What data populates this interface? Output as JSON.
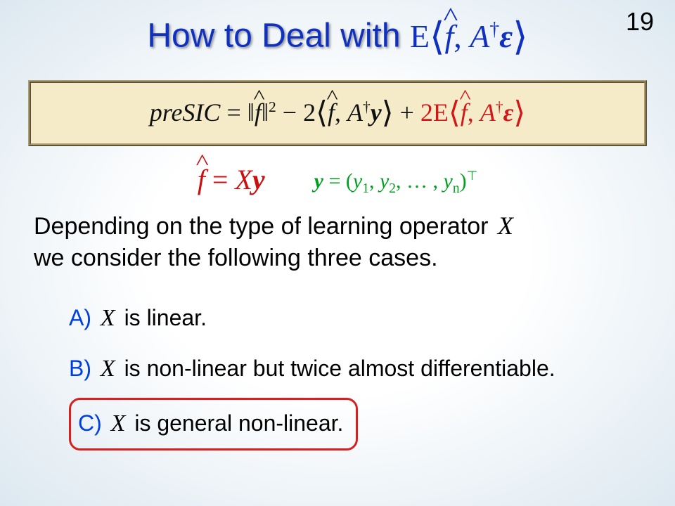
{
  "page_number": "19",
  "title": {
    "text": "How to Deal with ",
    "math_html": "E<span class='angle'>⟨</span><span class='ital hat'>f</span>, <span class='ital'>A</span><span class='sup'>†</span><span class='bold ital'>ε</span><span class='angle'>⟩</span>"
  },
  "formula": {
    "black_html": "<span class='ital'>preSIC</span> = ‖<span class='ital hat'>f</span>‖<span class='sup'>2</span> − 2<span class='angle'>⟨</span><span class='ital hat'>f</span>, <span class='ital'>A</span><span class='sup'>†</span><span class='bold ital'>y</span><span class='angle'>⟩</span> + ",
    "red_html": "2E<span class='angle'>⟨</span><span class='ital hat'>f</span>, <span class='ital'>A</span><span class='sup'>†</span><span class='bold ital'>ε</span><span class='angle'>⟩</span>"
  },
  "midline": {
    "red_html": "<span class='ital hat'>f</span> = <span class='ital'>X</span><span class='bold ital'>y</span>",
    "green_html": "<span class='bold ital'>y</span> = (<span class='ital'>y</span><span class='sub'>1</span>, <span class='ital'>y</span><span class='sub'>2</span>, … , <span class='ital'>y</span><span class='sub'>n</span>)<span class='sup'>⊤</span>"
  },
  "body": {
    "line1_a": "Depending on the type of learning operator ",
    "line1_x": "X",
    "line1_b": "we consider the following three cases."
  },
  "cases": {
    "a": {
      "label": "A)",
      "x": "X",
      "text": " is linear."
    },
    "b": {
      "label": "B)",
      "x": "X",
      "text": " is non-linear but twice almost differentiable."
    },
    "c": {
      "label": "C)",
      "x": "X",
      "text": " is general non-linear."
    }
  }
}
